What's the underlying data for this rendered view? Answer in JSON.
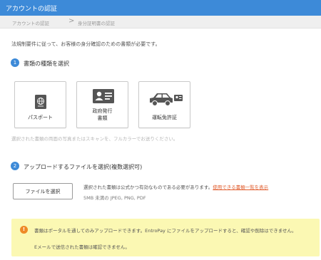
{
  "header": {
    "title": "アカウントの認証"
  },
  "breadcrumb": {
    "items": [
      "アカウントの認証",
      "身分証明書の認証"
    ],
    "separator": ">"
  },
  "intro": "法規制要件に従って、お客様の身分確認のための書類が必要です。",
  "step1": {
    "number": "1",
    "title": "書類の種類を選択",
    "documents": [
      {
        "label": "パスポート",
        "icon": "passport-icon"
      },
      {
        "label": "政府発行\n書類",
        "icon": "id-card-icon"
      },
      {
        "label": "運転免許証",
        "icon": "car-license-icon"
      }
    ],
    "note": "選択された書類の両面の写真またはスキャンを、フルカラーでお送りください。"
  },
  "step2": {
    "number": "2",
    "title": "アップロードするファイルを選択(複数選択可)",
    "button_label": "ファイルを選択",
    "description": "選択された書類は公式かつ有効なものである必要があります。",
    "link_text": "使用できる書類一覧を表示",
    "file_constraints": "5MB 未満の JPEG, PNG, PDF"
  },
  "warning": {
    "icon": "info-icon",
    "line1": "書類はポータルを通してのみアップロードできます。EntroPay にファイルをアップロードすると、確認や削除はできません。",
    "line2": "Eメールで送信された書類は確認できません。"
  },
  "colors": {
    "header_bg": "#3d8ad8",
    "step_circle": "#3d8ad8",
    "link": "#e05a2a",
    "warning_bg": "#fbf8b3",
    "warning_icon": "#ee8a27"
  }
}
